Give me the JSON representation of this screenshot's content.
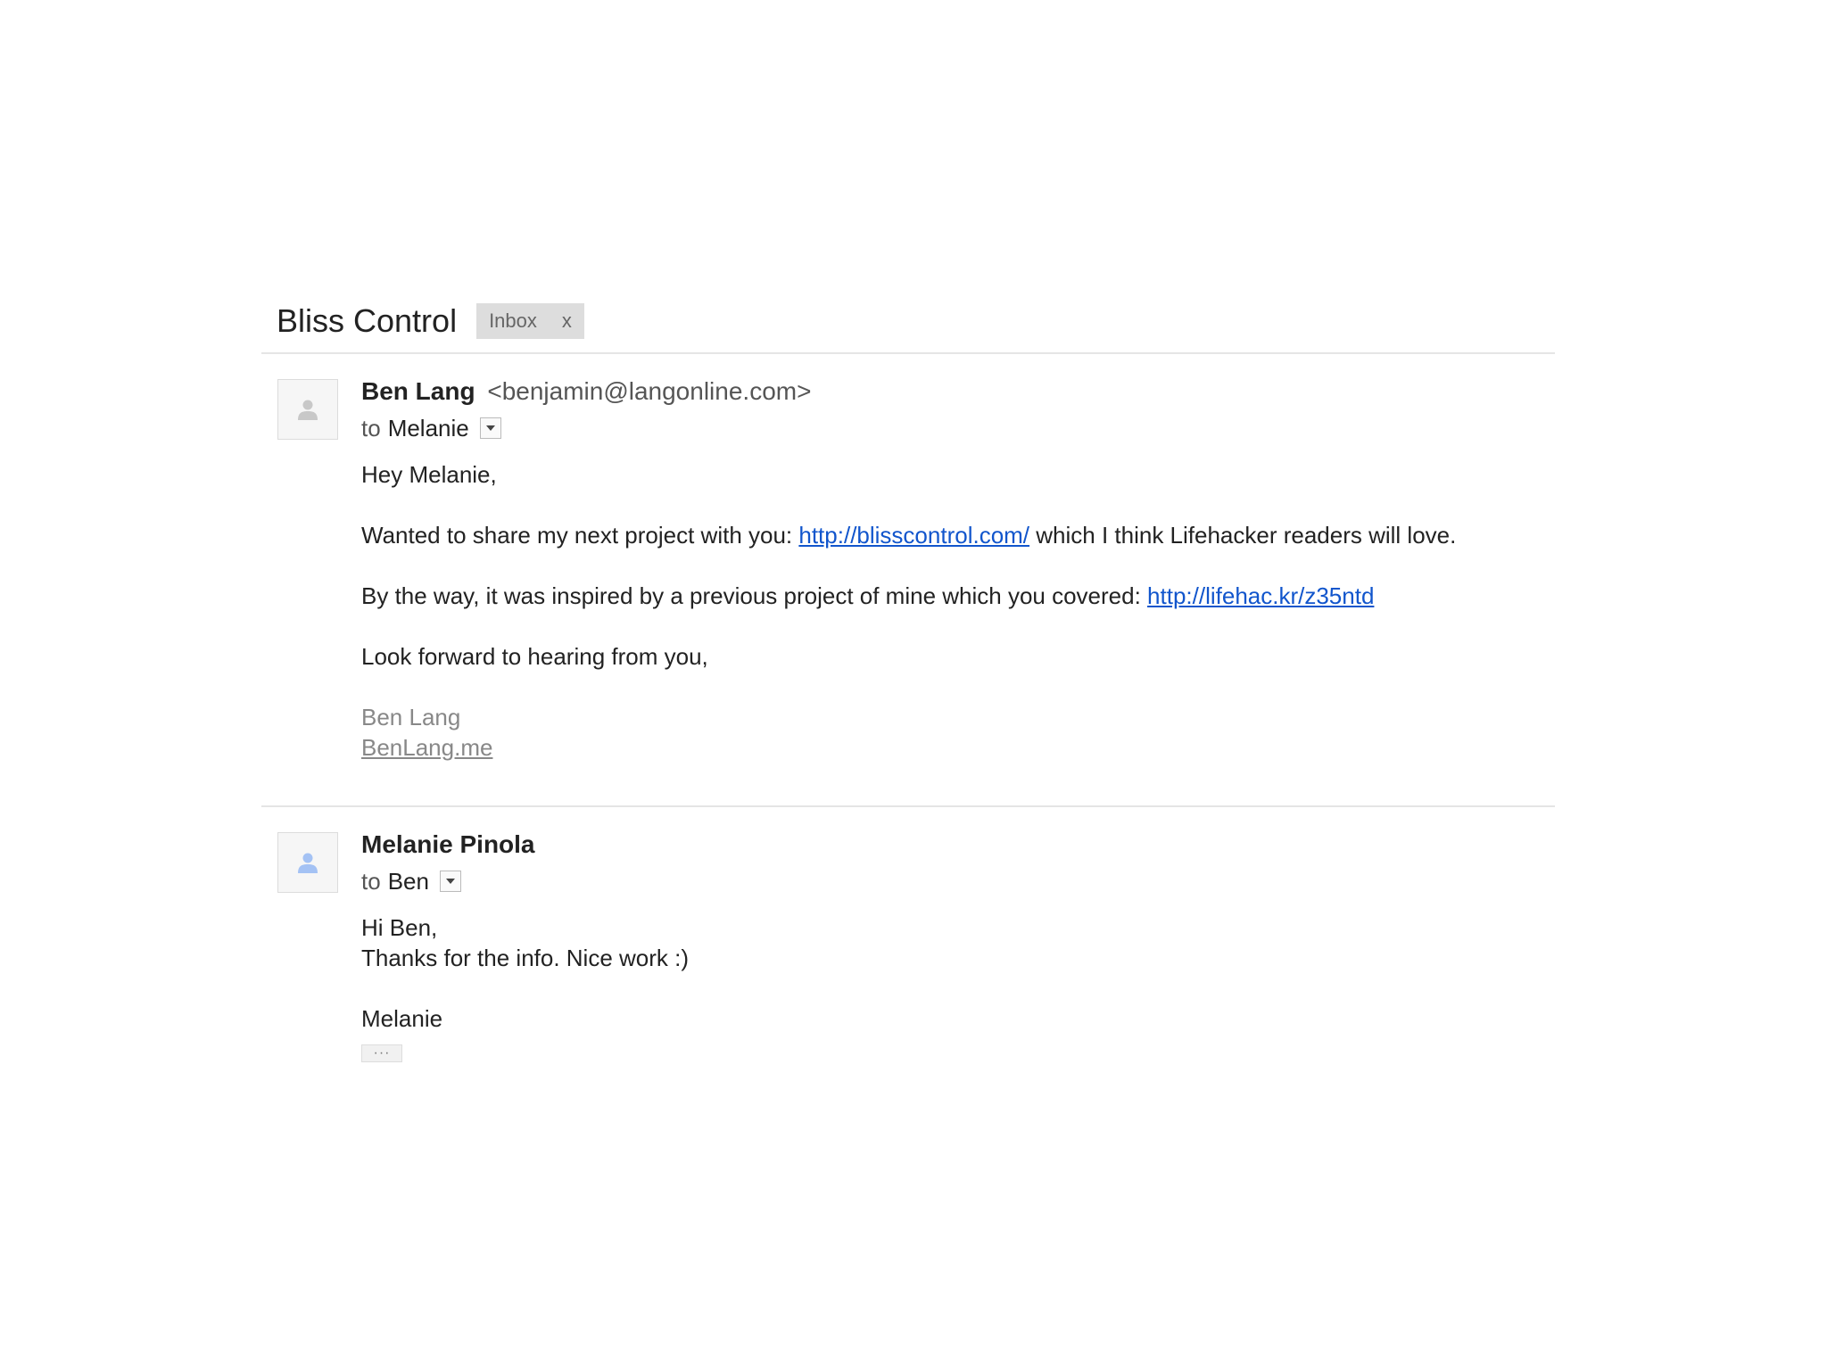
{
  "thread": {
    "subject": "Bliss Control",
    "label": "Inbox",
    "label_remove": "x"
  },
  "messages": [
    {
      "sender_name": "Ben Lang",
      "sender_email": "<benjamin@langonline.com>",
      "to_label": "to",
      "to_name": "Melanie",
      "avatar_icon": "person-icon",
      "greeting": "Hey Melanie,",
      "para1_before": "Wanted to share my next project with you: ",
      "para1_link": "http://blisscontrol.com/",
      "para1_after": " which I think Lifehacker readers will love.",
      "para2_before": "By the way, it was inspired by a previous project of mine which you covered: ",
      "para2_link": "http://lifehac.kr/z35ntd",
      "closing": "Look forward to hearing from you,",
      "sig_name": "Ben Lang",
      "sig_link": "BenLang.me"
    },
    {
      "sender_name": "Melanie Pinola",
      "to_label": "to",
      "to_name": "Ben",
      "avatar_icon": "person-icon",
      "line1": "Hi Ben,",
      "line2": "Thanks for the info. Nice work :)",
      "sign": "Melanie",
      "trimmed_content": "···"
    }
  ],
  "colors": {
    "link": "#1155cc",
    "avatar_grey": "#c8c8c8",
    "avatar_blue": "#a4c2f4"
  }
}
